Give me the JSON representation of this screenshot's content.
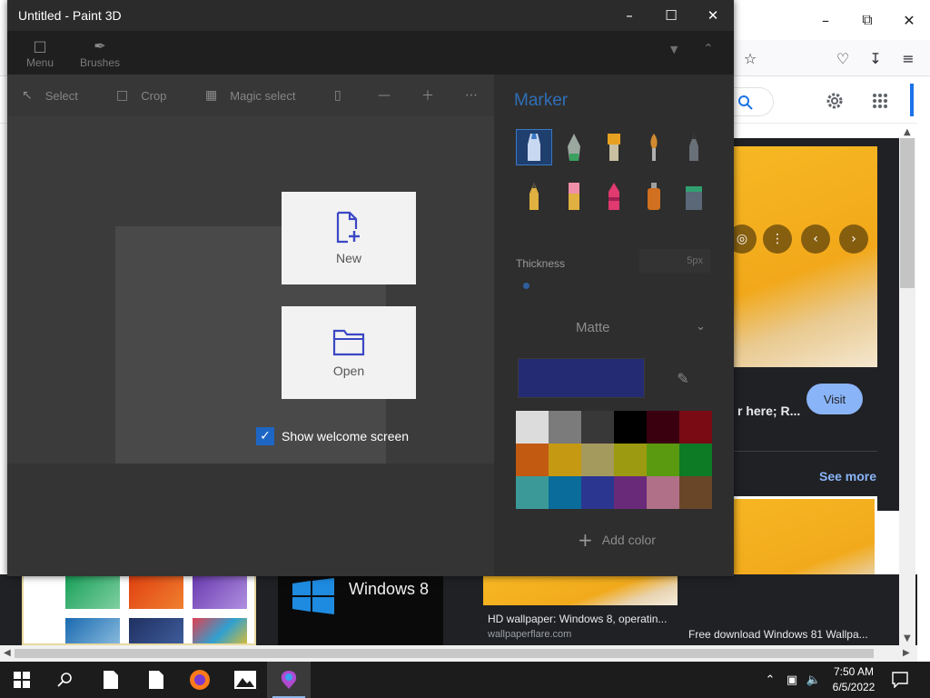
{
  "paint3d": {
    "window_title": "Untitled - Paint 3D",
    "ribbon": {
      "menu": "Menu",
      "brushes": "Brushes"
    },
    "tools": {
      "select": "Select",
      "crop": "Crop",
      "magic_select": "Magic select"
    },
    "panel": {
      "title": "Marker",
      "thickness_label": "Thickness",
      "thickness_value": "5px",
      "finish": "Matte",
      "current_color": "#252b72",
      "add_color": "Add color",
      "brushes": [
        "marker",
        "calligraphy-pen",
        "oil-brush",
        "watercolor",
        "pixel-pen",
        "pencil",
        "eraser",
        "crayon",
        "spray-can",
        "fill"
      ],
      "palette": [
        "#dcdcdc",
        "#7b7b7b",
        "#383838",
        "#000000",
        "#3a0010",
        "#7a0a14",
        "#c25a12",
        "#c59a12",
        "#a59a5e",
        "#9c9a10",
        "#5a9a10",
        "#0d7a26",
        "#3b9a98",
        "#0a6c9a",
        "#2b3690",
        "#6a2a7a",
        "#b07088",
        "#6a4628"
      ]
    },
    "welcome": {
      "new_label": "New",
      "open_label": "Open",
      "show_welcome_label": "Show welcome screen",
      "show_welcome_checked": true
    }
  },
  "browser": {
    "visit_label": "Visit",
    "hero_caption": "r here; R...",
    "see_more": "See more",
    "windows8_text": "Windows 8",
    "result1_title": "HD wallpaper: Windows 8, operatin...",
    "result1_source": "wallpaperflare.com",
    "result2_title": "Free download Windows 81 Wallpa..."
  },
  "taskbar": {
    "time": "7:50 AM",
    "date": "6/5/2022"
  }
}
